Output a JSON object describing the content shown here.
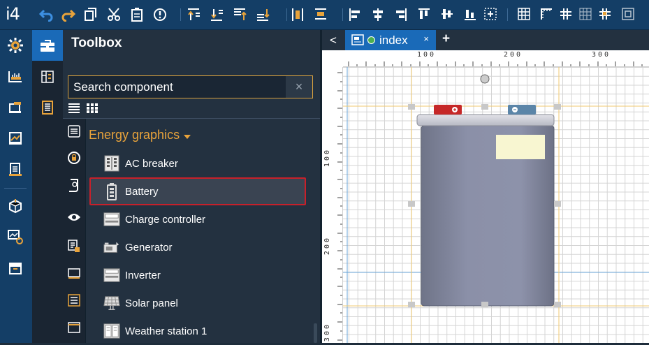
{
  "app": {
    "logo": "i4"
  },
  "toolbar": {
    "icons": [
      "undo-icon",
      "redo-icon",
      "copy-icon",
      "cut-icon",
      "paste-icon",
      "warning-icon",
      "bring-forward-icon",
      "send-backward-icon",
      "bring-to-front-icon",
      "send-to-back-icon",
      "distribute-horizontal-icon",
      "distribute-vertical-icon",
      "align-left-icon",
      "align-center-icon",
      "align-right-icon",
      "align-top-icon",
      "align-middle-icon",
      "align-bottom-icon",
      "center-icon",
      "grid-icon",
      "ruler-icon",
      "snap-grid-icon",
      "snap-icon",
      "snap-objects-icon",
      "fit-icon"
    ]
  },
  "toolbox": {
    "title": "Toolbox",
    "search": {
      "placeholder": "Search component",
      "clear": "×"
    },
    "category": {
      "title": "Energy graphics"
    },
    "items": [
      {
        "label": "AC breaker"
      },
      {
        "label": "Battery"
      },
      {
        "label": "Charge controller"
      },
      {
        "label": "Generator"
      },
      {
        "label": "Inverter"
      },
      {
        "label": "Solar panel"
      },
      {
        "label": "Weather station 1"
      }
    ],
    "selected_item": "Battery"
  },
  "tabs": {
    "back": "<",
    "active": {
      "label": "index",
      "close": "×"
    },
    "add": "+"
  },
  "canvas": {
    "ruler_h_labels": [
      "100",
      "200",
      "300"
    ],
    "ruler_v_labels": [
      "100",
      "200",
      "300"
    ]
  },
  "colors": {
    "accent": "#e8a33b",
    "selection": "#c8202a",
    "tab": "#1a6ab8",
    "status_dot": "#4caf50"
  }
}
